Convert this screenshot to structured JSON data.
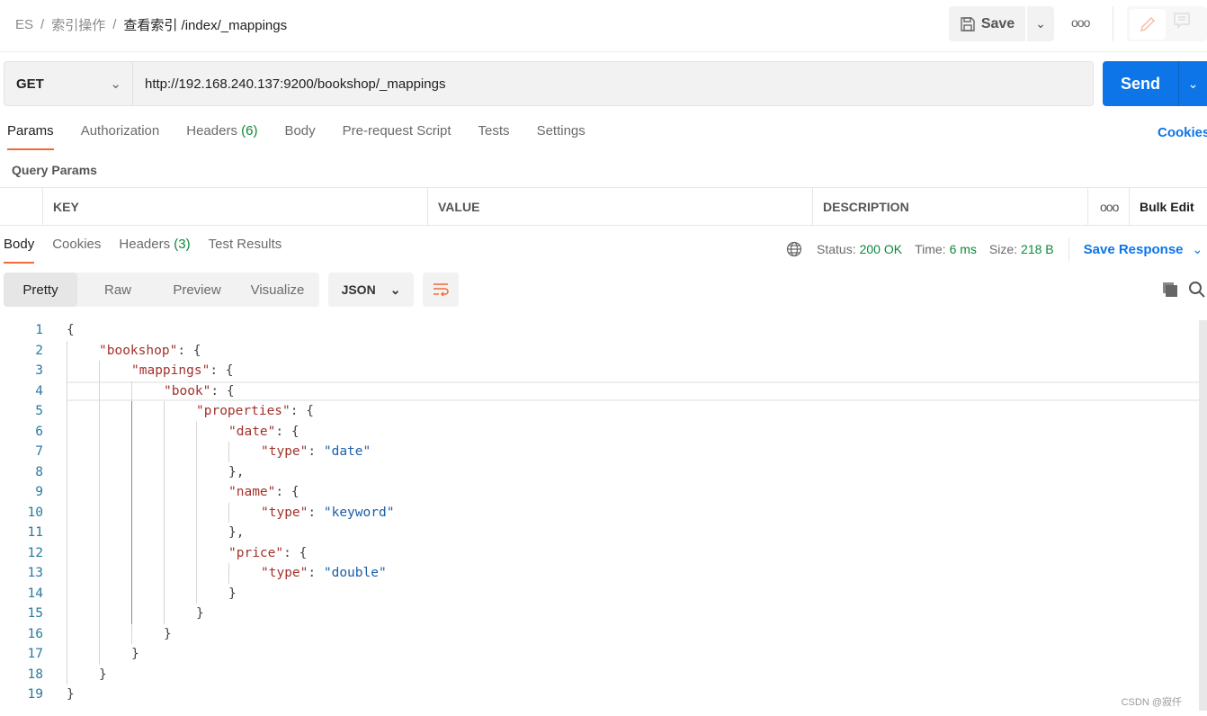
{
  "breadcrumb": [
    "ES",
    "索引操作",
    "查看索引 /index/_mappings"
  ],
  "header": {
    "save_label": "Save"
  },
  "request": {
    "method": "GET",
    "url": "http://192.168.240.137:9200/bookshop/_mappings",
    "send_label": "Send"
  },
  "request_tabs": [
    {
      "label": "Params",
      "active": true
    },
    {
      "label": "Authorization"
    },
    {
      "label": "Headers",
      "count": "(6)"
    },
    {
      "label": "Body"
    },
    {
      "label": "Pre-request Script"
    },
    {
      "label": "Tests"
    },
    {
      "label": "Settings"
    }
  ],
  "cookies_label": "Cookies",
  "query_params": {
    "title": "Query Params",
    "columns": [
      "KEY",
      "VALUE",
      "DESCRIPTION"
    ],
    "bulk_edit": "Bulk Edit"
  },
  "response_tabs": [
    {
      "label": "Body",
      "active": true
    },
    {
      "label": "Cookies"
    },
    {
      "label": "Headers",
      "count": "(3)"
    },
    {
      "label": "Test Results"
    }
  ],
  "status": {
    "status_label": "Status:",
    "status": "200 OK",
    "time_label": "Time:",
    "time": "6 ms",
    "size_label": "Size:",
    "size": "218 B",
    "save_response": "Save Response"
  },
  "view_modes": [
    {
      "label": "Pretty",
      "active": true
    },
    {
      "label": "Raw"
    },
    {
      "label": "Preview"
    },
    {
      "label": "Visualize"
    }
  ],
  "format": "JSON",
  "accent": "#f26b3a",
  "brand": "#0d75e8",
  "code_lines": [
    "{",
    "    \"bookshop\": {",
    "        \"mappings\": {",
    "            \"book\": {",
    "                \"properties\": {",
    "                    \"date\": {",
    "                        \"type\": \"date\"",
    "                    },",
    "                    \"name\": {",
    "                        \"type\": \"keyword\"",
    "                    },",
    "                    \"price\": {",
    "                        \"type\": \"double\"",
    "                    }",
    "                }",
    "            }",
    "        }",
    "    }",
    "}"
  ],
  "watermark": "CSDN @寂仟"
}
